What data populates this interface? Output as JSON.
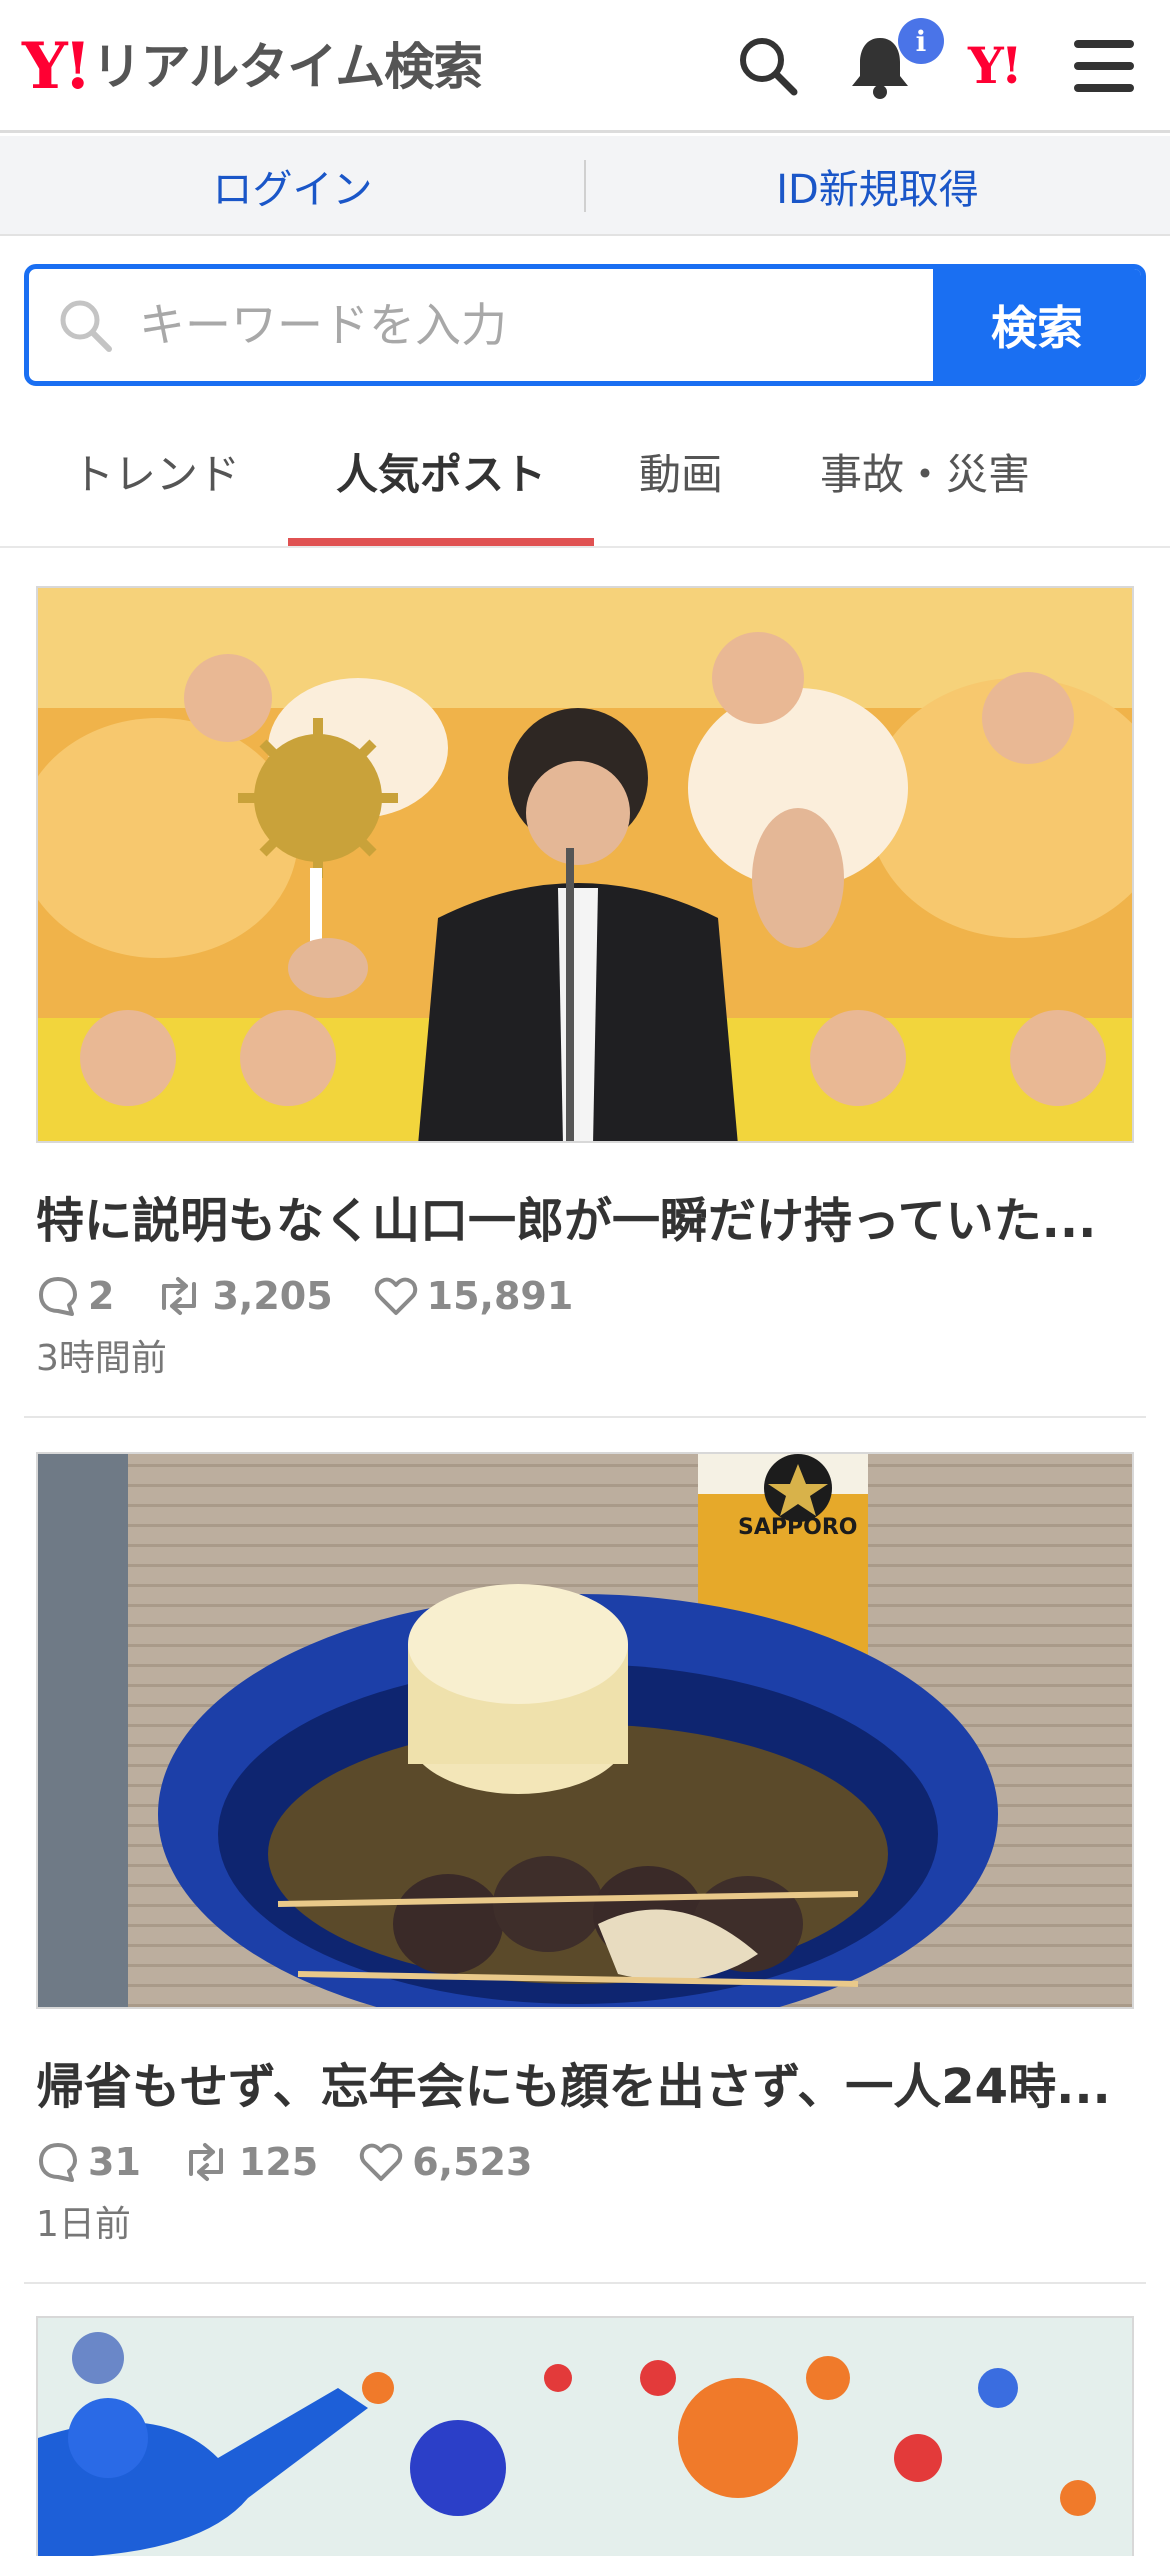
{
  "header": {
    "logo_mark": "Y!",
    "logo_text": "リアルタイム検索",
    "notification_badge": "i",
    "yahoo_mark": "Y!"
  },
  "auth": {
    "login_label": "ログイン",
    "register_label": "ID新規取得"
  },
  "search": {
    "placeholder": "キーワードを入力",
    "button_label": "検索"
  },
  "tabs": [
    {
      "label": "トレンド",
      "active": false
    },
    {
      "label": "人気ポスト",
      "active": true
    },
    {
      "label": "動画",
      "active": false
    },
    {
      "label": "事故・災害",
      "active": false
    }
  ],
  "posts": [
    {
      "title": "特に説明もなく山口一郎が一瞬だけ持っていた...",
      "replies": "2",
      "reposts": "3,205",
      "likes": "15,891",
      "time": "3時間前",
      "image": "performer-on-stage-with-cheerleaders"
    },
    {
      "title": "帰省もせず、忘年会にも顔を出さず、一人24時...",
      "replies": "31",
      "reposts": "125",
      "likes": "6,523",
      "time": "1日前",
      "image": "oden-bowl-and-beer-glass"
    },
    {
      "image": "paint-splatter-costume-performer"
    }
  ],
  "colors": {
    "brand_red": "#ff0033",
    "accent_blue": "#1a6ff2",
    "link_blue": "#1a56c8",
    "active_tab_underline": "#e05252"
  }
}
